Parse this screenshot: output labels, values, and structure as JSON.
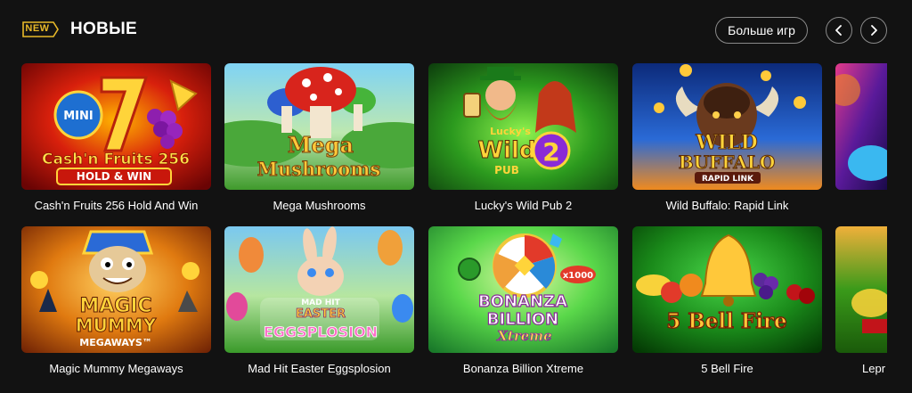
{
  "header": {
    "badge": "NEW",
    "title": "НОВЫЕ",
    "more_label": "Больше игр"
  },
  "games": [
    {
      "title": "Cash'n Fruits 256 Hold And Win",
      "art": {
        "line1": "Cash'n Fruits 256",
        "line2": "HOLD & WIN",
        "mini": "MINI"
      }
    },
    {
      "title": "Mega Mushrooms",
      "art": {
        "line1": "Mega",
        "line2": "Mushrooms"
      }
    },
    {
      "title": "Lucky's Wild Pub 2",
      "art": {
        "line1": "Lucky's",
        "line2": "Wild",
        "num": "2",
        "line3": "PUB"
      }
    },
    {
      "title": "Wild Buffalo: Rapid Link",
      "art": {
        "line1": "WILD",
        "line2": "BUFFALO",
        "line3": "RAPID LINK"
      }
    },
    {
      "title": "Magic Mummy Megaways",
      "art": {
        "line1": "MAGIC",
        "line2": "MUMMY",
        "line3": "MEGAWAYS™"
      }
    },
    {
      "title": "Mad Hit Easter Eggsplosion",
      "art": {
        "line1": "MAD HIT",
        "line2": "EASTER",
        "line3": "EGGSPLOSION"
      }
    },
    {
      "title": "Bonanza Billion Xtreme",
      "art": {
        "line1": "BONANZA",
        "line2": "BILLION",
        "line3": "Xtreme",
        "badge": "x1000"
      }
    },
    {
      "title": "5 Bell Fire",
      "art": {
        "line1": "5 Bell Fire"
      }
    },
    {
      "title": "Lepr"
    }
  ]
}
